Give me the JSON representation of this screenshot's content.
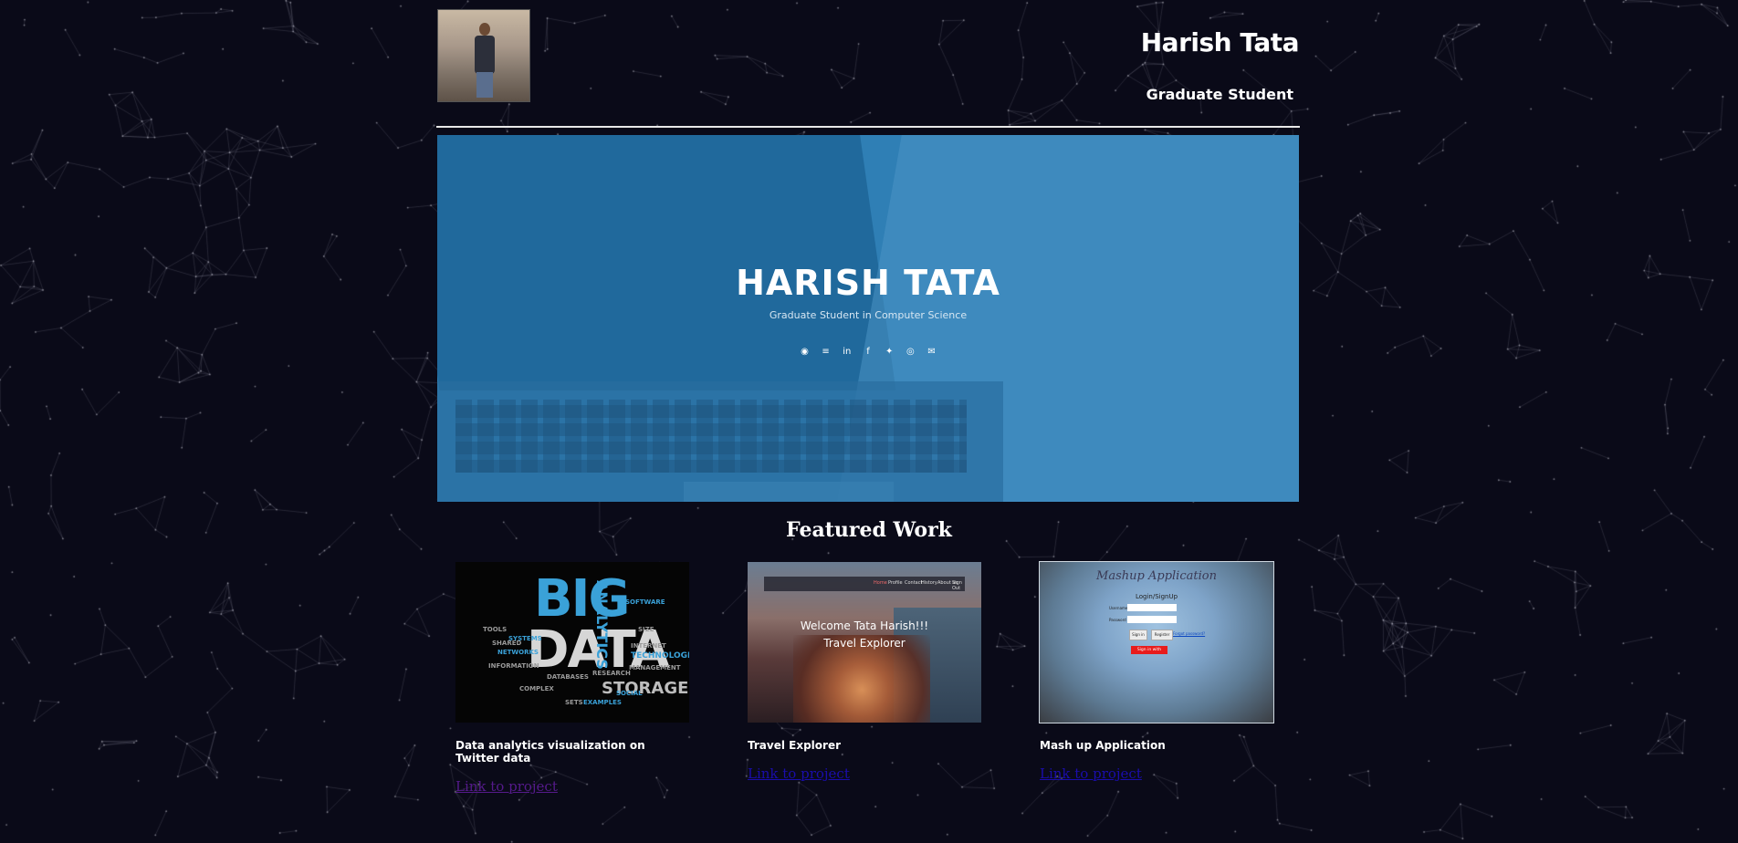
{
  "header": {
    "name": "Harish Tata",
    "role": "Graduate Student",
    "avatar_icon": "profile-photo"
  },
  "hero": {
    "title": "HARISH TATA",
    "subtitle": "Graduate Student in Computer Science",
    "social_icons": [
      "github-icon",
      "stackoverflow-icon",
      "linkedin-icon",
      "facebook-icon",
      "twitter-icon",
      "instagram-icon",
      "email-icon"
    ],
    "social_glyphs": [
      "◉",
      "≡",
      "in",
      "f",
      "✦",
      "◎",
      "✉"
    ],
    "background_color": "#2f7fb5"
  },
  "featured": {
    "title": "Featured Work",
    "projects": [
      {
        "caption": "Data analytics visualization on Twitter data",
        "link_text": "Link to project",
        "thumb": {
          "big": "BIG",
          "data": "DATA",
          "analytics": "ANALYTICS",
          "storage": "STORAGE",
          "words": [
            "SOFTWARE",
            "SIZE",
            "INTERNET",
            "TECHNOLOGIES",
            "MANAGEMENT",
            "INFORMATION",
            "COMPLEX",
            "DATABASES",
            "SETS",
            "NETWORKS",
            "SYSTEMS",
            "TOOLS",
            "SHARED",
            "EXAMPLES",
            "RESEARCH",
            "SOCIAL"
          ]
        }
      },
      {
        "caption": "Travel Explorer",
        "link_text": "Link to project",
        "thumb": {
          "nav_items": [
            "Home",
            "Profile",
            "Contact",
            "History",
            "About us",
            "Sign Out"
          ],
          "welcome": "Welcome Tata Harish!!!",
          "subtitle": "Travel Explorer"
        }
      },
      {
        "caption": "Mash up Application",
        "link_text": "Link to project",
        "thumb": {
          "title": "Mashup Application",
          "login": "Login/SignUp",
          "username_label": "Username",
          "password_label": "Password",
          "signin_btn": "Sign in",
          "register_btn": "Register",
          "forgot": "Forgot password?",
          "signin_with": "Sign in with"
        }
      }
    ]
  },
  "colors": {
    "page_background": "#0a0a18",
    "visited_link": "#551a8b",
    "link": "#1a0dab"
  }
}
